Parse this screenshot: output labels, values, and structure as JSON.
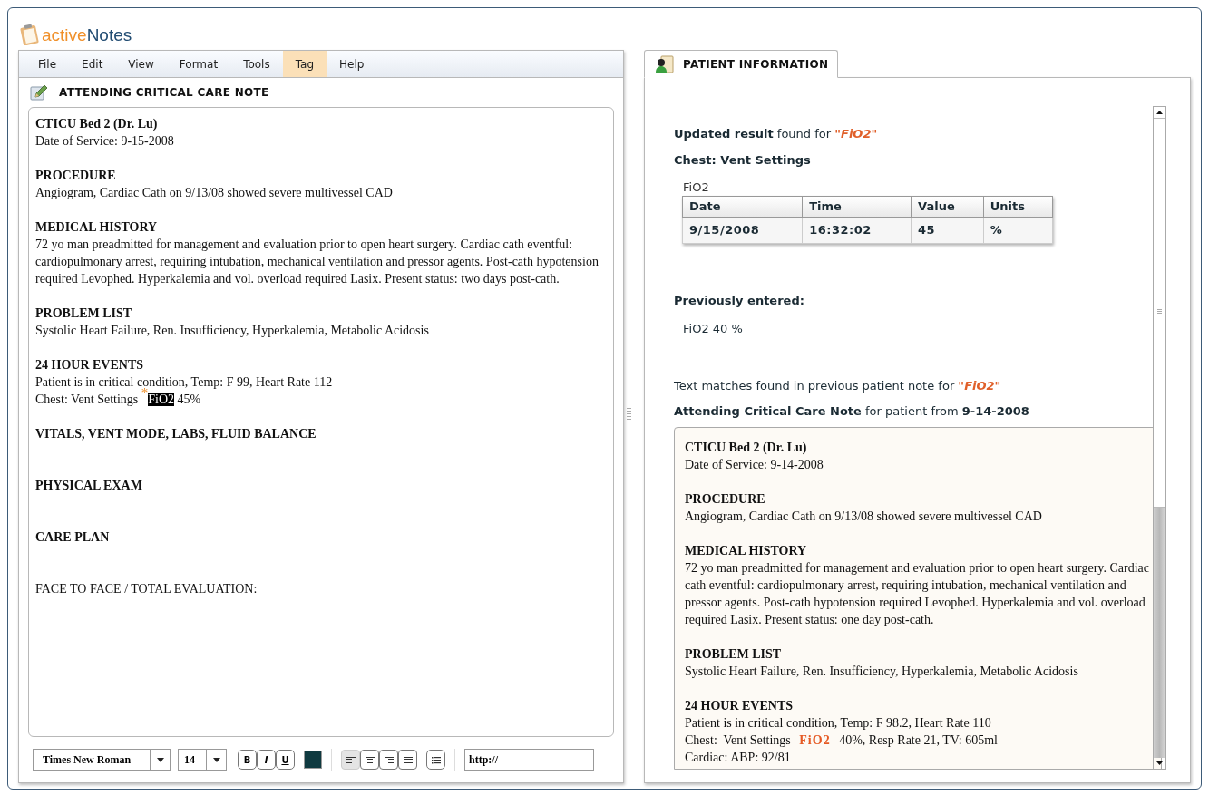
{
  "app": {
    "logo_a": "active",
    "logo_b": "Notes"
  },
  "menu": [
    {
      "label": "File",
      "selected": false
    },
    {
      "label": "Edit",
      "selected": false
    },
    {
      "label": "View",
      "selected": false
    },
    {
      "label": "Format",
      "selected": false
    },
    {
      "label": "Tools",
      "selected": false
    },
    {
      "label": "Tag",
      "selected": true
    },
    {
      "label": "Help",
      "selected": false
    }
  ],
  "note": {
    "title": "ATTENDING CRITICAL CARE NOTE",
    "sections": [
      {
        "heading": "CTICU Bed 2 (Dr. Lu)",
        "lines": [
          [
            {
              "kind": "plain",
              "text": "Date of Service: 9-15-2008"
            }
          ]
        ]
      },
      {
        "heading": "PROCEDURE",
        "lines": [
          [
            {
              "kind": "plain",
              "text": "Angiogram, Cardiac Cath on 9/13/08 showed severe multivessel CAD"
            }
          ]
        ]
      },
      {
        "heading": "MEDICAL HISTORY",
        "lines": [
          [
            {
              "kind": "plain",
              "text": "72 yo man preadmitted for management and evaluation prior to open heart surgery. Cardiac cath eventful: cardiopulmonary arrest, requiring intubation, mechanical ventilation and pressor agents. Post-cath hypotension required Levophed. Hyperkalemia and vol. overload required Lasix. Present status: two days post-cath."
            }
          ]
        ]
      },
      {
        "heading": "PROBLEM LIST",
        "lines": [
          [
            {
              "kind": "plain",
              "text": "Systolic Heart Failure, Ren. Insufficiency, Hyperkalemia, Metabolic Acidosis"
            }
          ]
        ]
      },
      {
        "heading": "24 HOUR EVENTS",
        "lines": [
          [
            {
              "kind": "plain",
              "text": "Patient is in critical condition, Temp: F 99, Heart Rate 112"
            }
          ],
          [
            {
              "kind": "plain",
              "text": "Chest: Vent Settings "
            },
            {
              "kind": "mark",
              "text": "*"
            },
            {
              "kind": "selected",
              "text": "FiO2"
            },
            {
              "kind": "plain",
              "text": " 45%"
            }
          ]
        ]
      },
      {
        "heading": "VITALS, VENT MODE, LABS, FLUID BALANCE"
      },
      {
        "heading": "PHYSICAL EXAM"
      },
      {
        "heading": "CARE PLAN"
      },
      {
        "lines": [
          [
            {
              "kind": "plain",
              "text": "FACE TO FACE / TOTAL EVALUATION:"
            }
          ]
        ]
      }
    ]
  },
  "toolbar": {
    "font": "Times New Roman",
    "size": "14",
    "styles": [
      {
        "label": "B",
        "kind": "bold"
      },
      {
        "label": "I",
        "kind": "italic"
      },
      {
        "label": "U",
        "kind": "underline"
      }
    ],
    "align": [
      {
        "kind": "left",
        "selected": true
      },
      {
        "kind": "center",
        "selected": false
      },
      {
        "kind": "right",
        "selected": false
      },
      {
        "kind": "justify",
        "selected": false
      }
    ],
    "link": "http://"
  },
  "patient_tab": {
    "label": "PATIENT INFORMATION",
    "selected": true
  },
  "result": {
    "sentence": [
      {
        "kind": "bold",
        "text": "Updated result"
      },
      {
        "kind": "plain",
        "text": " found for "
      },
      {
        "kind": "term",
        "text": "\"FiO2\""
      }
    ],
    "group": "Chest: Vent Settings",
    "caption": "FiO2",
    "columns": [
      "Date",
      "Time",
      "Value",
      "Units"
    ],
    "rows": [
      [
        "9/15/2008",
        "16:32:02",
        "45",
        "%"
      ]
    ]
  },
  "previous": {
    "label": "Previously entered:",
    "value": "FiO2 40 %"
  },
  "matches": {
    "sentence": [
      {
        "kind": "plain",
        "text": "Text matches found in previous patient note for "
      },
      {
        "kind": "term",
        "text": "\"FiO2\""
      }
    ],
    "source": [
      {
        "kind": "bold",
        "text": "Attending Critical Care Note"
      },
      {
        "kind": "plain",
        "text": " for patient from "
      },
      {
        "kind": "bold",
        "text": "9-14-2008"
      }
    ]
  },
  "previous_note": {
    "sections": [
      {
        "heading": "CTICU Bed 2 (Dr. Lu)",
        "lines": [
          [
            {
              "kind": "plain",
              "text": "Date of Service: 9-14-2008"
            }
          ]
        ]
      },
      {
        "heading": "PROCEDURE",
        "lines": [
          [
            {
              "kind": "plain",
              "text": "Angiogram, Cardiac Cath on 9/13/08 showed severe multivessel CAD"
            }
          ]
        ]
      },
      {
        "heading": "MEDICAL HISTORY",
        "lines": [
          [
            {
              "kind": "plain",
              "text": "72 yo man preadmitted for management and evaluation prior to open heart surgery. Cardiac cath eventful: cardiopulmonary arrest, requiring intubation, mechanical ventilation and pressor agents. Post-cath hypotension required Levophed. Hyperkalemia and vol. overload required Lasix. Present status: one day post-cath."
            }
          ]
        ]
      },
      {
        "heading": "PROBLEM LIST",
        "lines": [
          [
            {
              "kind": "plain",
              "text": "Systolic Heart Failure, Ren. Insufficiency, Hyperkalemia, Metabolic Acidosis"
            }
          ]
        ]
      },
      {
        "heading": "24 HOUR EVENTS",
        "lines": [
          [
            {
              "kind": "plain",
              "text": "Patient is in critical condition, Temp: F 98.2, Heart Rate 110"
            }
          ],
          [
            {
              "kind": "plain",
              "text": "Chest:  Vent Settings "
            },
            {
              "kind": "hit",
              "text": "FiO2"
            },
            {
              "kind": "plain",
              "text": " 40%, Resp Rate 21, TV: 605ml"
            }
          ],
          [
            {
              "kind": "plain",
              "text": "Cardiac: ABP: 92/81"
            }
          ]
        ]
      }
    ]
  }
}
